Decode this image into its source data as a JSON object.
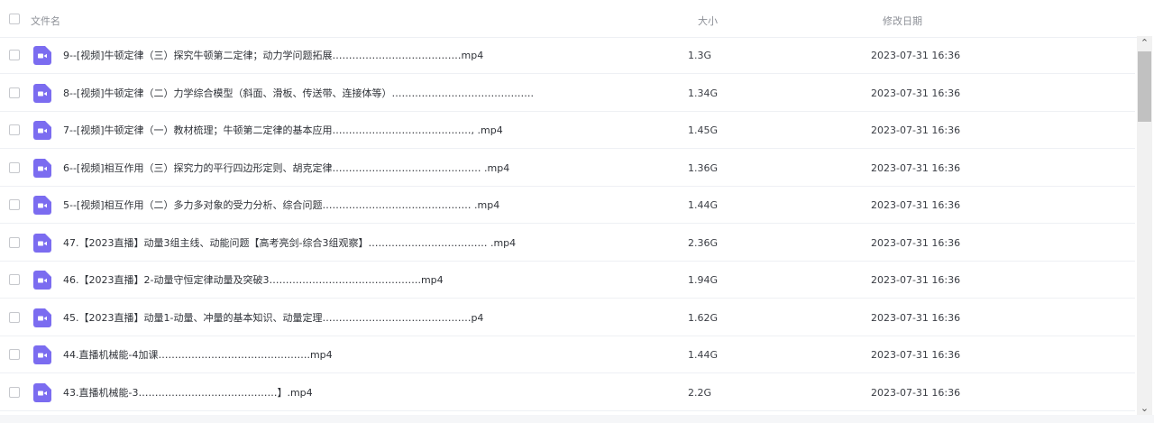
{
  "header": {
    "name_label": "文件名",
    "size_label": "大小",
    "date_label": "修改日期"
  },
  "files": [
    {
      "name": "9--[视频]牛顿定律（三）探究牛顿第二定律；动力学问题拓展…………………………………mp4",
      "size": "1.3G",
      "date": "2023-07-31 16:36"
    },
    {
      "name": "8--[视频]牛顿定律（二）力学综合模型（斜面、滑板、传送带、连接体等）…………………………………….",
      "size": "1.34G",
      "date": "2023-07-31 16:36"
    },
    {
      "name": "7--[视频]牛顿定律（一）教材梳理；牛顿第二定律的基本应用……………………………………, .mp4",
      "size": "1.45G",
      "date": "2023-07-31 16:36"
    },
    {
      "name": "6--[视频]相互作用（三）探究力的平行四边形定则、胡克定律……………………………………… .mp4",
      "size": "1.36G",
      "date": "2023-07-31 16:36"
    },
    {
      "name": "5--[视频]相互作用（二）多力多对象的受力分析、综合问题……………………………………… .mp4",
      "size": "1.44G",
      "date": "2023-07-31 16:36"
    },
    {
      "name": "47.【2023直播】动量3组主线、动能问题【高考亮剑-综合3组观察】……………………………… .mp4",
      "size": "2.36G",
      "date": "2023-07-31 16:36"
    },
    {
      "name": "46.【2023直播】2-动量守恒定律动量及突破3……………………………………….mp4",
      "size": "1.94G",
      "date": "2023-07-31 16:36"
    },
    {
      "name": "45.【2023直播】动量1-动量、冲量的基本知识、动量定理………………………………………p4",
      "size": "1.62G",
      "date": "2023-07-31 16:36"
    },
    {
      "name": "44.直播机械能-4加课……………………………………….mp4",
      "size": "1.44G",
      "date": "2023-07-31 16:36"
    },
    {
      "name": "43.直播机械能-3……………………………………】.mp4",
      "size": "2.2G",
      "date": "2023-07-31 16:36"
    }
  ],
  "colors": {
    "video_icon": "#7b6cf0",
    "border": "#eef0f4"
  },
  "icons": {
    "file_type": "video-file-icon",
    "scroll_up": "scroll-up-arrow-icon",
    "scroll_down": "scroll-down-arrow-icon"
  }
}
